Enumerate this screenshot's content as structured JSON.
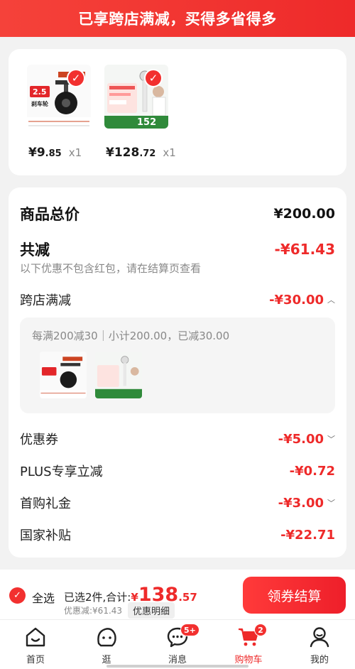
{
  "banner": {
    "text": "已享跨店满减，买得多省得多"
  },
  "products": [
    {
      "price_int": "¥9",
      "price_dec": ".85",
      "qty": "x1",
      "thumb_label": "2.5寸 刹车轮"
    },
    {
      "price_int": "¥128",
      "price_dec": ".72",
      "qty": "x1",
      "thumb_label": "152"
    }
  ],
  "summary": {
    "subtotal_label": "商品总价",
    "subtotal_value": "¥200.00",
    "discount_label": "共减",
    "discount_value": "-¥61.43",
    "note": "以下优惠不包含红包，请在结算页查看",
    "crossstore_label": "跨店满减",
    "crossstore_value": "-¥30.00",
    "crossstore_detail": "每满200减30｜小计200.00，已减30.00",
    "coupon_label": "优惠券",
    "coupon_value": "-¥5.00",
    "plus_label": "PLUS专享立减",
    "plus_value": "-¥0.72",
    "firstbuy_label": "首购礼金",
    "firstbuy_value": "-¥3.00",
    "subsidy_label": "国家补贴",
    "subsidy_value": "-¥22.71"
  },
  "bottom": {
    "select_all": "全选",
    "selected_text": "已选2件,合计:",
    "total_cur": "¥",
    "total_int": "138",
    "total_dec": ".57",
    "discount_text": "优惠减:¥61.43",
    "detail_button": "优惠明细",
    "checkout_button": "领券结算"
  },
  "tabs": [
    {
      "label": "首页",
      "icon": "home-icon"
    },
    {
      "label": "逛",
      "icon": "browse-face-icon"
    },
    {
      "label": "消息",
      "icon": "message-icon",
      "badge": "5+"
    },
    {
      "label": "购物车",
      "icon": "cart-icon",
      "badge": "2"
    },
    {
      "label": "我的",
      "icon": "profile-icon"
    }
  ],
  "colors": {
    "accent": "#ee2a2a"
  }
}
